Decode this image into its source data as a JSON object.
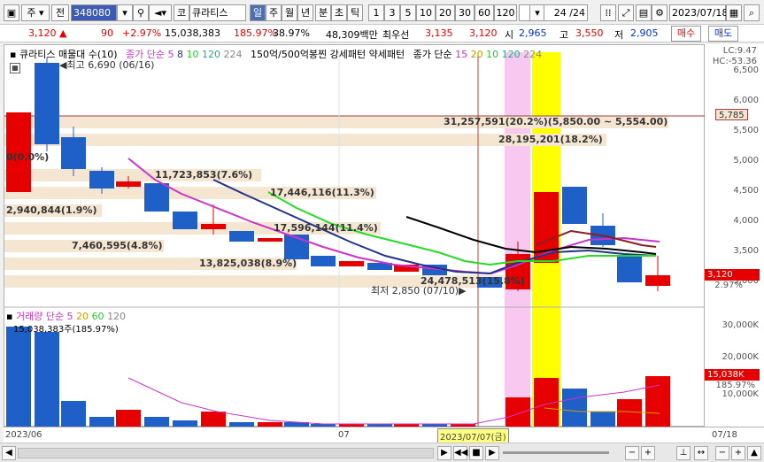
{
  "toolbar": {
    "type_label": "주",
    "all_label": "전",
    "code": "348080",
    "market_label": "코",
    "name": "큐라티스",
    "period_tabs": [
      "일",
      "주",
      "월",
      "년",
      "분",
      "초",
      "틱"
    ],
    "numbers": [
      "1",
      "3",
      "5",
      "10",
      "20",
      "30",
      "60",
      "120"
    ],
    "count": "24",
    "count_total": "/24",
    "date": "2023/07/18"
  },
  "info": {
    "price": "3,120",
    "change": "90",
    "change_pct": "+2.97%",
    "volume": "15,038,383",
    "volume_pct": "185.97%",
    "ratio": "38.97%",
    "amount": "48,309백만",
    "pref_label": "최우선",
    "pref_ask": "3,135",
    "pref_bid": "3,120",
    "open_label": "시",
    "open": "2,965",
    "high_label": "고",
    "high": "3,550",
    "low_label": "저",
    "low": "2,905",
    "buy_label": "매수",
    "sell_label": "매도"
  },
  "legend": {
    "name": "큐라티스 매물대 수(10)",
    "ma_label": "종가 단순 5",
    "ma_periods": [
      "8",
      "10",
      "120",
      "224"
    ],
    "pattern": "150억/500억봉찐 강세패턴 약세패턴",
    "ma2_label": "종가 단순",
    "ma2_periods": [
      "15",
      "20",
      "10",
      "120",
      "224"
    ],
    "vol_label": "거래량 단순 5",
    "vol_periods": [
      "20",
      "60",
      "120"
    ]
  },
  "annotations": {
    "high": "최고 6,690 (06/16)",
    "low": "최저 2,850 (07/10)",
    "lc": "LC:9.47",
    "hc": "HC:-53.36",
    "vol_label": "15,038,383주(185.97%)",
    "cursor_date": "2023/07/07(금)",
    "x_start": "2023/06",
    "x_mid": "07",
    "x_end": "07/18"
  },
  "volume_profile": [
    {
      "label": "31,257,591(20.2%)(5,850.00 ~ 5,554.00)"
    },
    {
      "label": "28,195,201(18.2%)"
    },
    {
      "label": "0(0.0%)"
    },
    {
      "label": "11,723,853(7.6%)"
    },
    {
      "label": "2,940,844(1.9%)"
    },
    {
      "label": "17,446,116(11.3%)"
    },
    {
      "label": "17,596,144(11.4%)"
    },
    {
      "label": "7,460,595(4.8%)"
    },
    {
      "label": "13,825,038(8.9%)"
    },
    {
      "label": "24,478,513(15.8%)"
    }
  ],
  "y_price_labels": [
    "6,500",
    "6,000",
    "5,500",
    "5,000",
    "4,500",
    "4,000",
    "3,500",
    "3,000"
  ],
  "y_vol_labels": [
    "30,000K",
    "20,000K",
    "10,000K"
  ],
  "price_tags": {
    "current": "3,120",
    "current_pct": "2.97%",
    "ref": "5,785",
    "vol": "15,038K",
    "vol_pct": "185.97%"
  },
  "colors": {
    "up": "#e60000",
    "down": "#1f5fc8",
    "profile": "#f5e6d2"
  }
}
